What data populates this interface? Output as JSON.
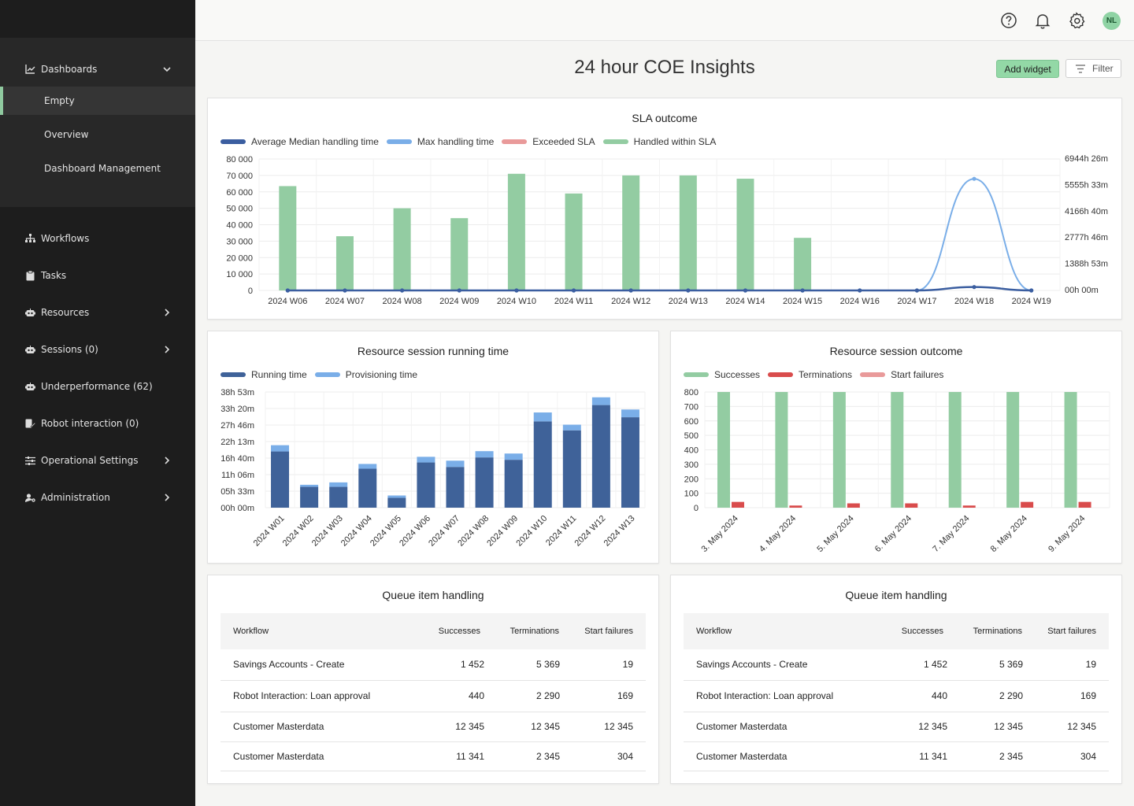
{
  "sidebar": {
    "dashboards": "Dashboards",
    "sub_items": [
      "Empty",
      "Overview",
      "Dashboard Management"
    ],
    "items": [
      "Workflows",
      "Tasks",
      "Resources",
      "Sessions (0)",
      "Underperformance (62)",
      "Robot interaction (0)",
      "Operational Settings",
      "Administration"
    ],
    "accent": "#8fc99f"
  },
  "topbar": {
    "icons": [
      "help-icon",
      "bell-icon",
      "gear-icon"
    ],
    "avatar_initials": "NL"
  },
  "page": {
    "title": "24 hour COE Insights",
    "add_widget": "Add widget",
    "filter": "Filter"
  },
  "sla_chart": {
    "title": "SLA outcome",
    "legend": [
      "Average Median handling time",
      "Max handling time",
      "Exceeded SLA",
      "Handled within SLA"
    ],
    "left_ticks": [
      "80 000",
      "70 000",
      "60 000",
      "50 000",
      "40 000",
      "30 000",
      "20 000",
      "10 000",
      "0"
    ],
    "right_ticks": [
      "6944h 26m",
      "5555h 33m",
      "4166h 40m",
      "2777h 46m",
      "1388h 53m",
      "00h 00m"
    ]
  },
  "resource_time_chart": {
    "title": "Resource session running time",
    "legend": [
      "Running time",
      "Provisioning time"
    ],
    "y_ticks": [
      "38h 53m",
      "33h 20m",
      "27h 46m",
      "22h 13m",
      "16h 40m",
      "11h 06m",
      "05h 33m",
      "00h 00m"
    ]
  },
  "resource_outcome_chart": {
    "title": "Resource session outcome",
    "legend": [
      "Successes",
      "Terminations",
      "Start failures"
    ],
    "y_ticks": [
      "800",
      "700",
      "600",
      "500",
      "400",
      "300",
      "200",
      "100",
      "0"
    ]
  },
  "chart_data": [
    {
      "type": "bar",
      "title": "SLA outcome",
      "categories": [
        "2024 W06",
        "2024 W07",
        "2024 W08",
        "2024 W09",
        "2024 W10",
        "2024 W11",
        "2024 W12",
        "2024 W13",
        "2024 W14",
        "2024 W15",
        "2024 W16",
        "2024 W17",
        "2024 W18",
        "2024 W19"
      ],
      "series": [
        {
          "name": "Handled within SLA",
          "type": "bar",
          "axis": "left",
          "color": "#93cca2",
          "values": [
            63500,
            33000,
            50000,
            44000,
            71000,
            59000,
            70000,
            70000,
            68000,
            32000,
            0,
            0,
            0,
            0
          ]
        },
        {
          "name": "Exceeded SLA",
          "type": "bar",
          "axis": "left",
          "color": "#e99a9a",
          "values": [
            0,
            0,
            0,
            0,
            0,
            0,
            0,
            0,
            0,
            0,
            0,
            0,
            0,
            0
          ]
        },
        {
          "name": "Max handling time",
          "type": "line",
          "axis": "right",
          "color": "#7aaee8",
          "values": [
            0,
            0,
            0,
            0,
            0,
            0,
            0,
            0,
            0,
            0,
            0,
            0,
            5897,
            0
          ]
        },
        {
          "name": "Average Median handling time",
          "type": "line",
          "axis": "right",
          "color": "#3b5ea0",
          "values": [
            0,
            0,
            0,
            0,
            0,
            0,
            0,
            0,
            0,
            0,
            0,
            0,
            180,
            0
          ]
        }
      ],
      "ylim": [
        0,
        80000
      ],
      "y2lim": [
        0,
        6944.44
      ],
      "y2_unit": "hours",
      "grid": true,
      "legend_position": "top-left"
    },
    {
      "type": "bar",
      "stacked": true,
      "title": "Resource session running time",
      "categories": [
        "2024 W01",
        "2024 W02",
        "2024 W03",
        "2024 W04",
        "2024 W05",
        "2024 W06",
        "2024 W07",
        "2024 W08",
        "2024 W09",
        "2024 W10",
        "2024 W11",
        "2024 W12",
        "2024 W13"
      ],
      "series": [
        {
          "name": "Running time",
          "color": "#3f6299",
          "values": [
            18.9,
            7.0,
            7.0,
            13.1,
            3.3,
            15.2,
            13.7,
            16.9,
            16.1,
            29.0,
            26.0,
            34.5,
            30.4
          ]
        },
        {
          "name": "Provisioning time",
          "color": "#7aaee8",
          "values": [
            2.1,
            0.7,
            1.5,
            1.6,
            0.8,
            1.9,
            2.1,
            2.1,
            2.1,
            3.0,
            1.9,
            2.6,
            2.6
          ]
        }
      ],
      "y_unit": "hours",
      "ylim": [
        0,
        38.89
      ],
      "grid": true,
      "legend_position": "top-left"
    },
    {
      "type": "bar",
      "title": "Resource session outcome",
      "categories": [
        "3. May 2024",
        "4. May 2024",
        "5. May 2024",
        "6. May 2024",
        "7. May 2024",
        "8. May 2024",
        "9. May 2024"
      ],
      "series": [
        {
          "name": "Successes",
          "color": "#93cca2",
          "values": [
            800,
            800,
            800,
            800,
            800,
            800,
            800
          ]
        },
        {
          "name": "Terminations",
          "color": "#d94c4c",
          "values": [
            40,
            15,
            30,
            30,
            15,
            40,
            40
          ]
        },
        {
          "name": "Start failures",
          "color": "#e99a9a",
          "values": [
            0,
            0,
            0,
            0,
            0,
            0,
            0
          ]
        }
      ],
      "ylim": [
        0,
        800
      ],
      "grid": true,
      "legend_position": "top-left"
    }
  ],
  "tables": [
    {
      "title": "Queue item handling",
      "headers": [
        "Workflow",
        "Successes",
        "Terminations",
        "Start failures"
      ],
      "rows": [
        [
          "Savings Accounts - Create",
          "1 452",
          "5 369",
          "19"
        ],
        [
          "Robot Interaction: Loan approval",
          "440",
          "2 290",
          "169"
        ],
        [
          "Customer Masterdata",
          "12 345",
          "12 345",
          "12 345"
        ],
        [
          "Customer Masterdata",
          "11 341",
          "2 345",
          "304"
        ]
      ]
    },
    {
      "title": "Queue item handling",
      "headers": [
        "Workflow",
        "Successes",
        "Terminations",
        "Start failures"
      ],
      "rows": [
        [
          "Savings Accounts - Create",
          "1 452",
          "5 369",
          "19"
        ],
        [
          "Robot Interaction: Loan approval",
          "440",
          "2 290",
          "169"
        ],
        [
          "Customer Masterdata",
          "12 345",
          "12 345",
          "12 345"
        ],
        [
          "Customer Masterdata",
          "11 341",
          "2 345",
          "304"
        ]
      ]
    }
  ]
}
